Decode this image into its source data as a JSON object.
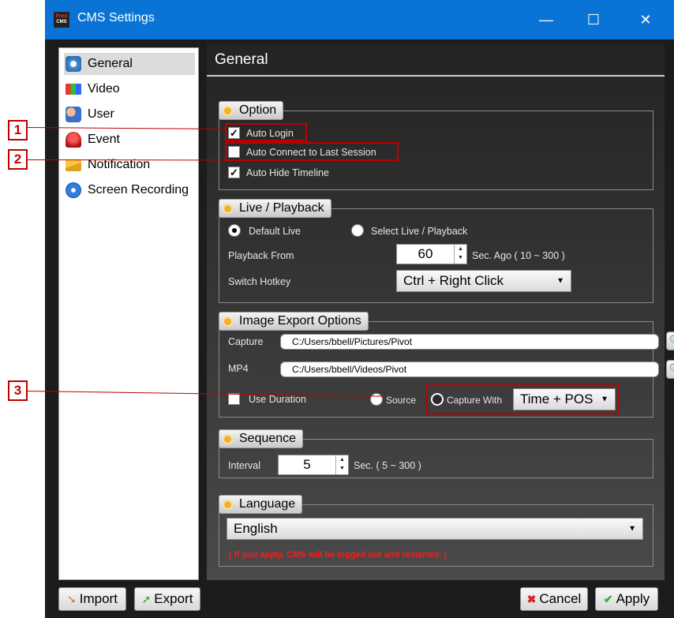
{
  "window": {
    "title": "CMS Settings",
    "app_icon_top": "Pivot",
    "app_icon_bottom": "CMS",
    "minimize": "—",
    "maximize": "☐",
    "close": "✕"
  },
  "sidebar": {
    "items": [
      {
        "label": "General",
        "icon": "gear-icon",
        "selected": true
      },
      {
        "label": "Video",
        "icon": "video-icon"
      },
      {
        "label": "User",
        "icon": "user-icon"
      },
      {
        "label": "Event",
        "icon": "siren-icon"
      },
      {
        "label": "Notification",
        "icon": "envelope-icon"
      },
      {
        "label": "Screen Recording",
        "icon": "film-reel-icon"
      }
    ]
  },
  "footer": {
    "import": "Import",
    "export": "Export",
    "cancel": "Cancel",
    "apply": "Apply"
  },
  "main": {
    "title": "General",
    "option": {
      "label": "Option",
      "auto_login": "Auto Login",
      "auto_login_checked": true,
      "auto_connect": "Auto Connect to Last Session",
      "auto_connect_checked": false,
      "auto_hide": "Auto Hide Timeline",
      "auto_hide_checked": true
    },
    "live": {
      "label": "Live / Playback",
      "default_live": "Default Live",
      "select_live": "Select Live / Playback",
      "playback_from": "Playback From",
      "playback_value": "60",
      "playback_unit": "Sec. Ago ( 10 ~ 300 )",
      "switch_hotkey": "Switch Hotkey",
      "hotkey_value": "Ctrl + Right Click"
    },
    "image_export": {
      "label": "Image Export Options",
      "capture": "Capture",
      "capture_path": "C:/Users/bbell/Pictures/Pivot",
      "mp4": "MP4",
      "mp4_path": "C:/Users/bbell/Videos/Pivot",
      "use_duration": "Use Duration",
      "source": "Source",
      "capture_with": "Capture With",
      "capture_with_value": "Time + POS"
    },
    "sequence": {
      "label": "Sequence",
      "interval": "Interval",
      "interval_value": "5",
      "interval_unit": "Sec. ( 5 ~ 300 )"
    },
    "language": {
      "label": "Language",
      "value": "English",
      "warning": "( If you apply, CMS will be logged out and restarted. )"
    }
  },
  "callouts": [
    "1",
    "2",
    "3"
  ],
  "colors": {
    "titlebar": "#0a74d6",
    "callout": "#c00000",
    "accent_dot": "#f0b030",
    "warning": "#ff1a1a"
  }
}
